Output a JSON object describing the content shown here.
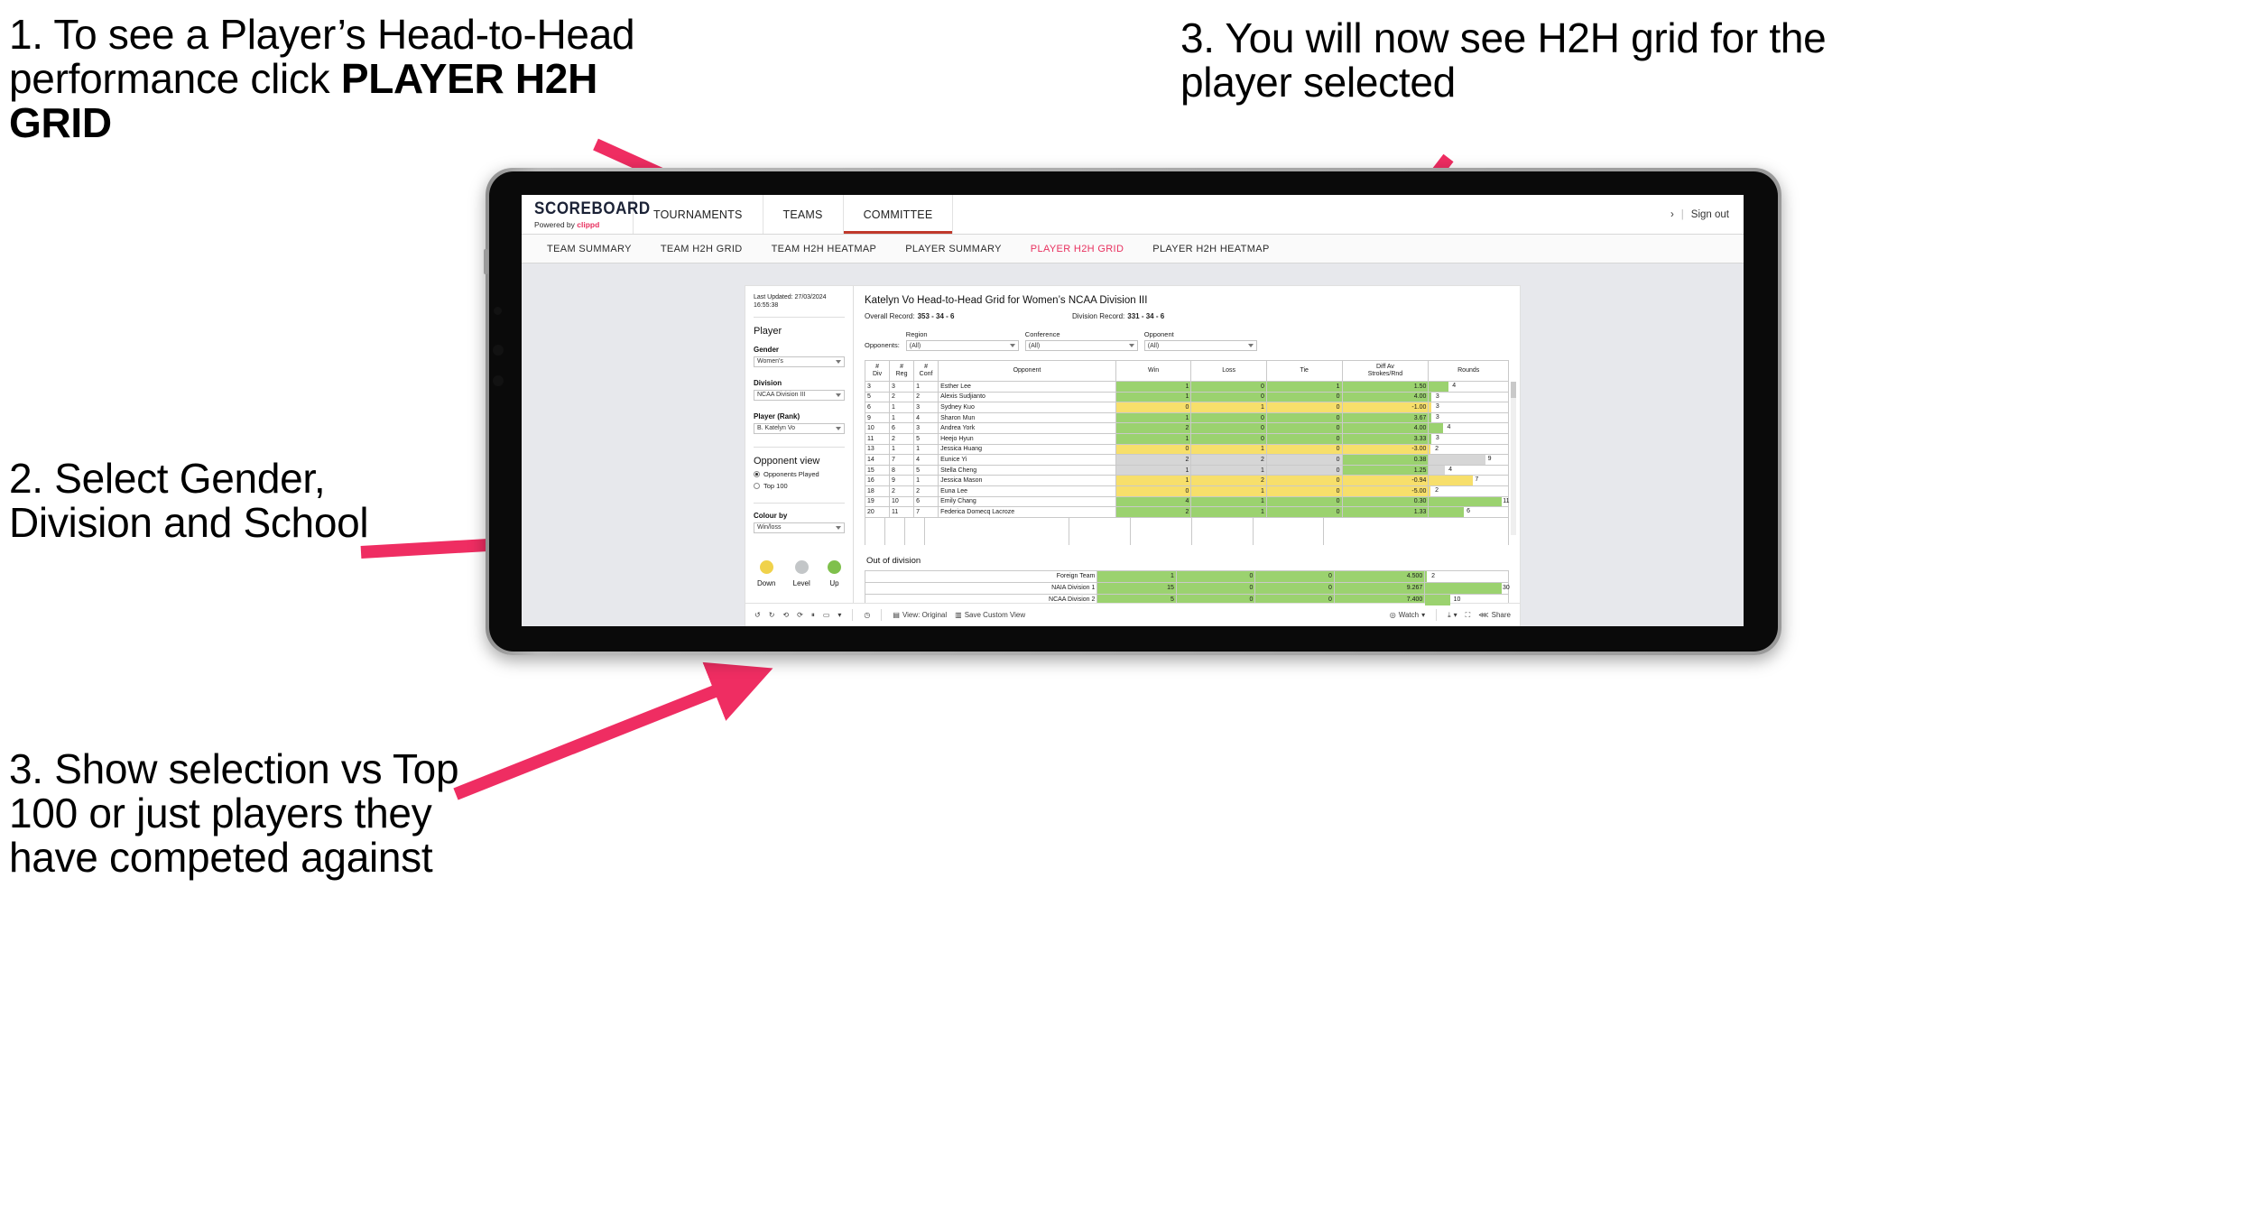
{
  "annotations": [
    {
      "id": "anno-1",
      "text_plain": "1. To see a Player’s Head-to-Head performance click ",
      "text_bold": "PLAYER H2H GRID"
    },
    {
      "id": "anno-2",
      "text": "2. Select Gender, Division and School"
    },
    {
      "id": "anno-3",
      "text": "3. Show selection vs Top 100 or just players they have competed against"
    },
    {
      "id": "anno-4",
      "text": "3. You will now see H2H grid for the player selected"
    }
  ],
  "colors": {
    "accent_pink": "#e8315f",
    "arrow_pink": "#ef2d62",
    "up_green": "#9bd26f",
    "down_yellow": "#f7df6b",
    "level_grey": "#d6d6d6"
  },
  "appbar": {
    "brand_title": "SCOREBOARD",
    "brand_sub_prefix": "Powered by ",
    "brand_sub_name": "clippd",
    "nav": [
      {
        "label": "TOURNAMENTS",
        "active": false
      },
      {
        "label": "TEAMS",
        "active": false
      },
      {
        "label": "COMMITTEE",
        "active": true
      }
    ],
    "account_chevron": "›",
    "separator": "|",
    "sign_out": "Sign out"
  },
  "subnav": [
    {
      "label": "TEAM SUMMARY",
      "active": false
    },
    {
      "label": "TEAM H2H GRID",
      "active": false
    },
    {
      "label": "TEAM H2H HEATMAP",
      "active": false
    },
    {
      "label": "PLAYER SUMMARY",
      "active": false
    },
    {
      "label": "PLAYER H2H GRID",
      "active": true
    },
    {
      "label": "PLAYER H2H HEATMAP",
      "active": false
    }
  ],
  "filters": {
    "last_updated_line1": "Last Updated: 27/03/2024",
    "last_updated_line2": "16:55:38",
    "player_group_title": "Player",
    "fields": [
      {
        "label": "Gender",
        "value": "Women's"
      },
      {
        "label": "Division",
        "value": "NCAA Division III"
      },
      {
        "label": "Player (Rank)",
        "value": "B. Katelyn Vo"
      }
    ],
    "opponent_view_title": "Opponent view",
    "opponent_view_options": [
      {
        "label": "Opponents Played",
        "selected": true
      },
      {
        "label": "Top 100",
        "selected": false
      }
    ],
    "colour_by_label": "Colour by",
    "colour_by_value": "Win/loss",
    "legend": [
      {
        "label": "Down",
        "color": "#f0d24b"
      },
      {
        "label": "Level",
        "color": "#c3c6c8"
      },
      {
        "label": "Up",
        "color": "#7fc04c"
      }
    ]
  },
  "main": {
    "title": "Katelyn Vo Head-to-Head Grid for Women’s NCAA Division III",
    "overall_record_label": "Overall Record:",
    "overall_record_value": "353 - 34 - 6",
    "division_record_label": "Division Record:",
    "division_record_value": "331 - 34 - 6",
    "opponents_label": "Opponents:",
    "opponent_filters": [
      {
        "label": "Region",
        "value": "(All)"
      },
      {
        "label": "Conference",
        "value": "(All)"
      },
      {
        "label": "Opponent",
        "value": "(All)"
      }
    ],
    "table_headers": [
      "#\nDiv",
      "#\nReg",
      "#\nConf",
      "Opponent",
      "Win",
      "Loss",
      "Tie",
      "Diff Av\nStrokes/Rnd",
      "Rounds"
    ],
    "out_of_division_title": "Out of division"
  },
  "chart_data": {
    "type": "table",
    "title": "Katelyn Vo Head-to-Head Grid for Women’s NCAA Division III",
    "columns": [
      "# Div",
      "# Reg",
      "# Conf",
      "Opponent",
      "Win",
      "Loss",
      "Tie",
      "Diff Av Strokes/Rnd",
      "Rounds"
    ],
    "rows": [
      {
        "div": "3",
        "reg": "3",
        "conf": "1",
        "opponent": "Esther Lee",
        "win": "1",
        "loss": "0",
        "tie": "1",
        "diff": "1.50",
        "rounds": "4",
        "state": "up",
        "rounds_pct": 25
      },
      {
        "div": "5",
        "reg": "2",
        "conf": "2",
        "opponent": "Alexis Sudjianto",
        "win": "1",
        "loss": "0",
        "tie": "0",
        "diff": "4.00",
        "rounds": "3",
        "state": "up",
        "rounds_pct": 3
      },
      {
        "div": "6",
        "reg": "1",
        "conf": "3",
        "opponent": "Sydney Kuo",
        "win": "0",
        "loss": "1",
        "tie": "0",
        "diff": "-1.00",
        "rounds": "3",
        "state": "down",
        "rounds_pct": 3
      },
      {
        "div": "9",
        "reg": "1",
        "conf": "4",
        "opponent": "Sharon Mun",
        "win": "1",
        "loss": "0",
        "tie": "0",
        "diff": "3.67",
        "rounds": "3",
        "state": "up",
        "rounds_pct": 3
      },
      {
        "div": "10",
        "reg": "6",
        "conf": "3",
        "opponent": "Andrea York",
        "win": "2",
        "loss": "0",
        "tie": "0",
        "diff": "4.00",
        "rounds": "4",
        "state": "up",
        "rounds_pct": 18
      },
      {
        "div": "11",
        "reg": "2",
        "conf": "5",
        "opponent": "Heejo Hyun",
        "win": "1",
        "loss": "0",
        "tie": "0",
        "diff": "3.33",
        "rounds": "3",
        "state": "up",
        "rounds_pct": 3
      },
      {
        "div": "13",
        "reg": "1",
        "conf": "1",
        "opponent": "Jessica Huang",
        "win": "0",
        "loss": "1",
        "tie": "0",
        "diff": "-3.00",
        "rounds": "2",
        "state": "down",
        "rounds_pct": 2
      },
      {
        "div": "14",
        "reg": "7",
        "conf": "4",
        "opponent": "Eunice Yi",
        "win": "2",
        "loss": "2",
        "tie": "0",
        "diff": "0.38",
        "rounds": "9",
        "state": "level",
        "rounds_pct": 72,
        "diff_state": "up"
      },
      {
        "div": "15",
        "reg": "8",
        "conf": "5",
        "opponent": "Stella Cheng",
        "win": "1",
        "loss": "1",
        "tie": "0",
        "diff": "1.25",
        "rounds": "4",
        "state": "level",
        "rounds_pct": 20,
        "diff_state": "up"
      },
      {
        "div": "16",
        "reg": "9",
        "conf": "1",
        "opponent": "Jessica Mason",
        "win": "1",
        "loss": "2",
        "tie": "0",
        "diff": "-0.94",
        "rounds": "7",
        "state": "down",
        "rounds_pct": 55
      },
      {
        "div": "18",
        "reg": "2",
        "conf": "2",
        "opponent": "Euna Lee",
        "win": "0",
        "loss": "1",
        "tie": "0",
        "diff": "-5.00",
        "rounds": "2",
        "state": "down",
        "rounds_pct": 2
      },
      {
        "div": "19",
        "reg": "10",
        "conf": "6",
        "opponent": "Emily Chang",
        "win": "4",
        "loss": "1",
        "tie": "0",
        "diff": "0.30",
        "rounds": "11",
        "state": "up",
        "rounds_pct": 92
      },
      {
        "div": "20",
        "reg": "11",
        "conf": "7",
        "opponent": "Federica Domecq Lacroze",
        "win": "2",
        "loss": "1",
        "tie": "0",
        "diff": "1.33",
        "rounds": "6",
        "state": "up",
        "rounds_pct": 44
      }
    ],
    "out_of_division_rows": [
      {
        "name": "Foreign Team",
        "win": "1",
        "loss": "0",
        "tie": "0",
        "diff": "4.500",
        "rounds": "2",
        "state": "up",
        "rounds_pct": 2
      },
      {
        "name": "NAIA Division 1",
        "win": "15",
        "loss": "0",
        "tie": "0",
        "diff": "9.267",
        "rounds": "30",
        "state": "up",
        "rounds_pct": 92
      },
      {
        "name": "NCAA Division 2",
        "win": "5",
        "loss": "0",
        "tie": "0",
        "diff": "7.400",
        "rounds": "10",
        "state": "up",
        "rounds_pct": 30
      }
    ]
  },
  "toolbar": {
    "view_label": "View: Original",
    "save_label": "Save Custom View",
    "watch_label": "Watch",
    "share_label": "Share"
  }
}
